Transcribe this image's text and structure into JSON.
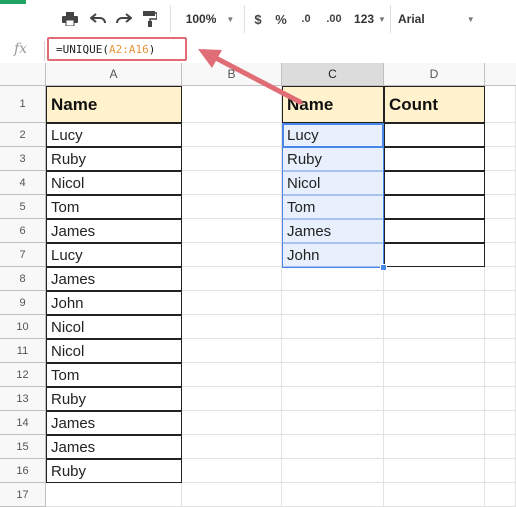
{
  "toolbar": {
    "zoom": "100%",
    "currency": "$",
    "percent": "%",
    "dec_decrease": ".0",
    "dec_increase": ".00",
    "number_format": "123",
    "font_name": "Arial",
    "caret": "▼"
  },
  "formula_bar": {
    "fx_label": "fx",
    "prefix": "=UNIQUE(",
    "range": "A2:A16",
    "suffix": ")"
  },
  "columns": [
    "A",
    "B",
    "C",
    "D"
  ],
  "active_column": "C",
  "rows": [
    "1",
    "2",
    "3",
    "4",
    "5",
    "6",
    "7",
    "8",
    "9",
    "10",
    "11",
    "12",
    "13",
    "14",
    "15",
    "16",
    "17"
  ],
  "column_a": {
    "header": "Name",
    "values": [
      "Lucy",
      "Ruby",
      "Nicol",
      "Tom",
      "James",
      "Lucy",
      "James",
      "John",
      "Nicol",
      "Nicol",
      "Tom",
      "Ruby",
      "James",
      "James",
      "Ruby"
    ]
  },
  "column_c": {
    "header": "Name",
    "values": [
      "Lucy",
      "Ruby",
      "Nicol",
      "Tom",
      "James",
      "John"
    ]
  },
  "column_d": {
    "header": "Count"
  },
  "colors": {
    "header_fill": "#fff2cc",
    "selection_fill": "#e8f0fe",
    "selection_border": "#4a86e8",
    "annotation": "#e06c75"
  }
}
